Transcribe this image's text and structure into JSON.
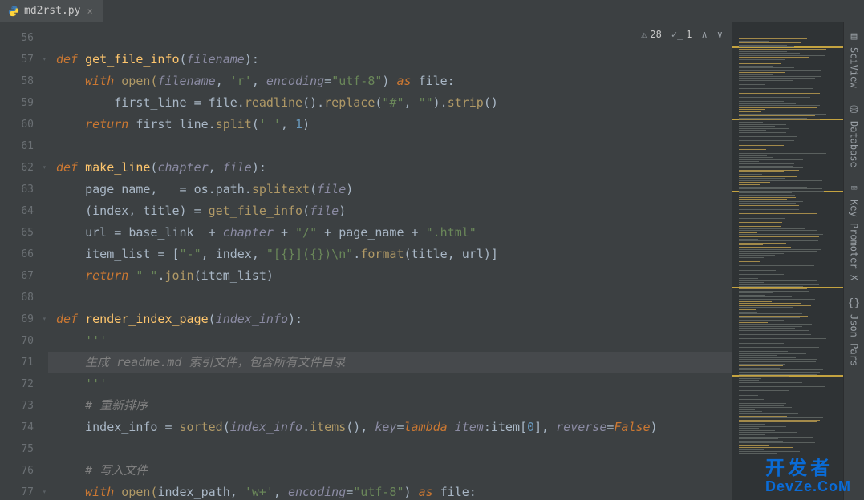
{
  "tab": {
    "filename": "md2rst.py",
    "close_label": "×"
  },
  "inspection": {
    "warning_count": "28",
    "typo_count": "1"
  },
  "gutter": {
    "start": 56,
    "lines": [
      56,
      57,
      58,
      59,
      60,
      61,
      62,
      63,
      64,
      65,
      66,
      67,
      68,
      69,
      70,
      71,
      72,
      73,
      74,
      75,
      76,
      77
    ]
  },
  "code": {
    "l56": "",
    "l57": {
      "def": "def ",
      "fn": "get_file_info",
      "open": "(",
      "p1": "filename",
      "close": "):"
    },
    "l58": {
      "indent": "    ",
      "with": "with ",
      "open": "open(",
      "p": "filename",
      "sep": ", ",
      "r": "'r'",
      "sep2": ", ",
      "kw": "encoding",
      "eq": "=",
      "enc": "\"utf-8\"",
      "close": ") ",
      "as": "as ",
      "var": "file:",
      "tail": ""
    },
    "l59": {
      "indent": "        ",
      "lhs": "first_line ",
      "op": "= ",
      "expr1": "file.",
      "m1": "readline",
      "p1": "().",
      "m2": "replace",
      "p2": "(",
      "s1": "\"#\"",
      "sep": ", ",
      "s2": "\"\"",
      "p3": ").",
      "m3": "strip",
      "p4": "()"
    },
    "l60": {
      "indent": "    ",
      "ret": "return ",
      "expr": "first_line.",
      "m": "split",
      "open": "(",
      "s": "' '",
      "sep": ", ",
      "n": "1",
      "close": ")"
    },
    "l61": "",
    "l62": {
      "def": "def ",
      "fn": "make_line",
      "open": "(",
      "p1": "chapter",
      "sep": ", ",
      "p2": "file",
      "close": "):"
    },
    "l63": {
      "indent": "    ",
      "lhs": "page_name, _ ",
      "op": "= ",
      "mod": "os.path.",
      "m": "splitext",
      "open": "(",
      "p": "file",
      "close": ")"
    },
    "l64": {
      "indent": "    ",
      "lhs": "(index, title) ",
      "op": "= ",
      "fn": "get_file_info",
      "open": "(",
      "p": "file",
      "close": ")"
    },
    "l65": {
      "indent": "    ",
      "lhs": "url ",
      "op": "= ",
      "v1": "base_link  ",
      "plus": "+ ",
      "v2": "chapter ",
      "plus2": "+ ",
      "s1": "\"/\" ",
      "plus3": "+ ",
      "v3": "page_name ",
      "plus4": "+ ",
      "s2": "\".html\""
    },
    "l66": {
      "indent": "    ",
      "lhs": "item_list ",
      "op": "= ",
      "open": "[",
      "s1": "\"-\"",
      "sep": ", ",
      "v1": "index",
      "sep2": ", ",
      "s2": "\"[{}]({})\\n\"",
      "dot": ".",
      "m": "format",
      "popen": "(",
      "a1": "title",
      "asep": ", ",
      "a2": "url",
      "pclose": ")]"
    },
    "l67": {
      "indent": "    ",
      "ret": "return ",
      "s": "\" \"",
      "dot": ".",
      "m": "join",
      "open": "(",
      "v": "item_list",
      "close": ")"
    },
    "l68": "",
    "l69": {
      "def": "def ",
      "fn": "render_index_page",
      "open": "(",
      "p1": "index_info",
      "close": "):"
    },
    "l70": {
      "indent": "    ",
      "doc": "'''"
    },
    "l71": {
      "indent": "    ",
      "txt": "生成 readme.md 索引文件，包含所有文件目录"
    },
    "l72": {
      "indent": "    ",
      "doc": "'''"
    },
    "l73": {
      "indent": "    ",
      "c": "# 重新排序"
    },
    "l74": {
      "indent": "    ",
      "lhs": "index_info ",
      "op": "= ",
      "fn": "sorted",
      "open": "(",
      "p": "index_info",
      "dot": ".",
      "m": "items",
      "p2": "(), ",
      "k1": "key",
      "eq": "=",
      "lam": "lambda ",
      "li": "item",
      "col": ":",
      "idx": "item[",
      "n": "0",
      "idx2": "], ",
      "k2": "reverse",
      "eq2": "=",
      "val": "False",
      "close": ")"
    },
    "l75": "",
    "l76": {
      "indent": "    ",
      "c": "# 写入文件"
    },
    "l77": {
      "indent": "    ",
      "with": "with ",
      "open": "open(",
      "v": "index_path",
      "sep": ", ",
      "s": "'w+'",
      "sep2": ", ",
      "kw": "encoding",
      "eq": "=",
      "enc": "\"utf-8\"",
      "close": ") ",
      "as": "as ",
      "var": "file:"
    }
  },
  "right_tools": [
    {
      "label": "SciView",
      "icon": "▤"
    },
    {
      "label": "Database",
      "icon": "⛁"
    },
    {
      "label": "Key Promoter X",
      "icon": "⌨"
    },
    {
      "label": "Json Pars",
      "icon": "{}"
    }
  ],
  "watermark": {
    "line1": "开发者",
    "line2": "DevZe.CoM"
  }
}
